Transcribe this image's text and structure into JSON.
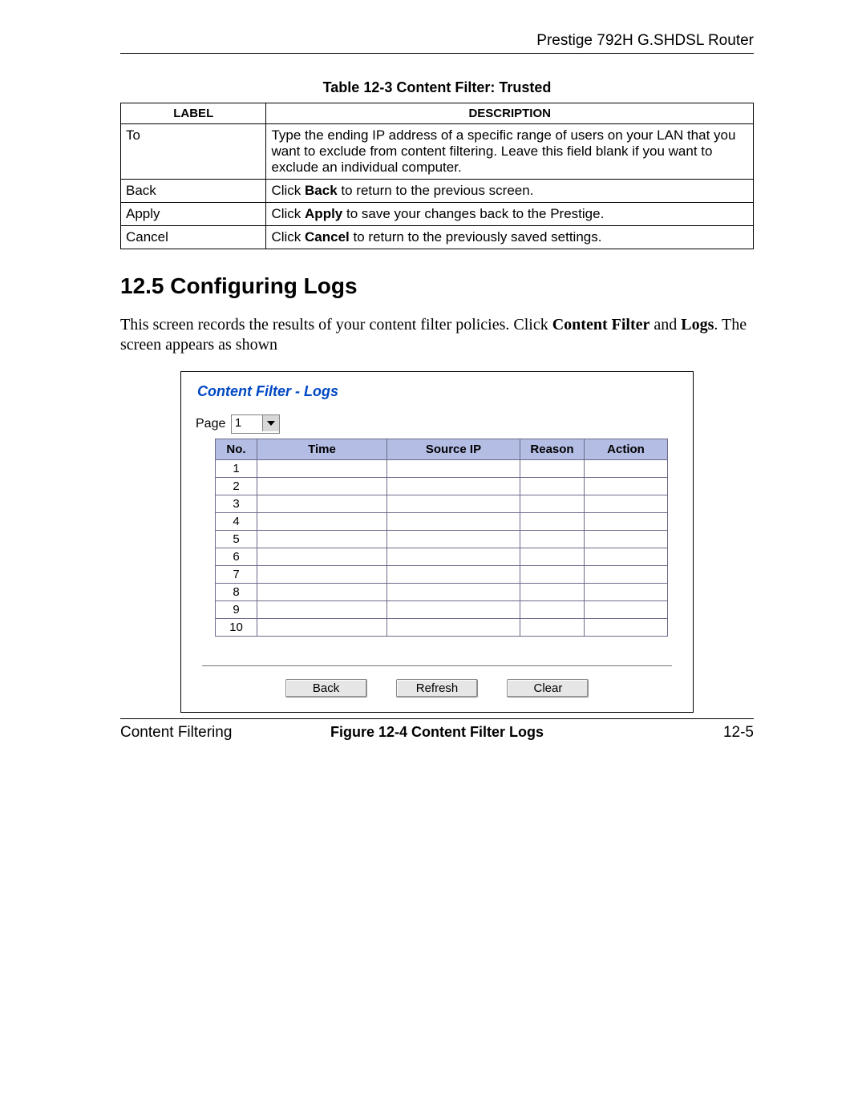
{
  "header": {
    "product": "Prestige 792H G.SHDSL Router"
  },
  "table_trusted": {
    "caption": "Table 12-3 Content Filter: Trusted",
    "head": {
      "label": "LABEL",
      "desc": "DESCRIPTION"
    },
    "rows": [
      {
        "label": "To",
        "desc_plain": "Type the ending IP address of a specific range of users on your LAN that you want to exclude from content filtering. Leave this field blank if you want to exclude an individual computer."
      },
      {
        "label": "Back",
        "desc_pre": "Click ",
        "desc_bold": "Back",
        "desc_post": " to return to the previous screen."
      },
      {
        "label": "Apply",
        "desc_pre": "Click ",
        "desc_bold": "Apply",
        "desc_post": " to save your changes back to the Prestige."
      },
      {
        "label": "Cancel",
        "desc_pre": "Click ",
        "desc_bold": "Cancel",
        "desc_post": " to return to the previously saved settings."
      }
    ]
  },
  "section": {
    "number_title": "12.5  Configuring Logs",
    "intro_pre": "This screen records the results of your content filter policies. Click ",
    "intro_b1": "Content Filter",
    "intro_mid": " and ",
    "intro_b2": "Logs",
    "intro_post": ". The screen appears as shown"
  },
  "figure": {
    "title": "Content Filter - Logs",
    "page_label": "Page",
    "page_value": "1",
    "columns": {
      "no": "No.",
      "time": "Time",
      "src": "Source IP",
      "reason": "Reason",
      "action": "Action"
    },
    "row_numbers": [
      "1",
      "2",
      "3",
      "4",
      "5",
      "6",
      "7",
      "8",
      "9",
      "10"
    ],
    "buttons": {
      "back": "Back",
      "refresh": "Refresh",
      "clear": "Clear"
    },
    "caption": "Figure 12-4 Content Filter Logs"
  },
  "footer": {
    "left": "Content Filtering",
    "right": "12-5"
  }
}
